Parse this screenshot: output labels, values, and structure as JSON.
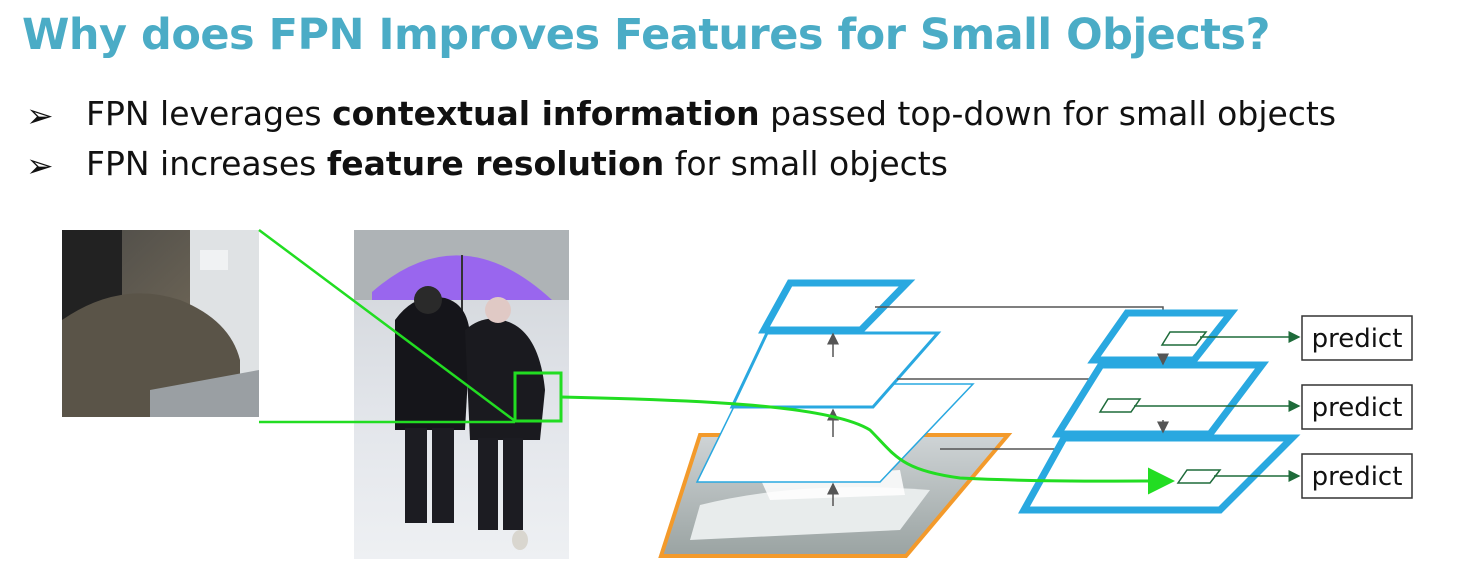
{
  "slide": {
    "title": "Why does FPN Improves Features for Small Objects?",
    "bullets": [
      {
        "pre": "FPN leverages ",
        "bold": "contextual information",
        "post": " passed top-down for small objects"
      },
      {
        "pre": "FPN increases ",
        "bold": "feature resolution",
        "post": " for small objects"
      }
    ]
  },
  "diagram": {
    "predict_labels": [
      "predict",
      "predict",
      "predict"
    ],
    "colors": {
      "pyramid_blue": "#29a8e0",
      "highlight_green": "#22dd22",
      "image_orange": "#f39a2b",
      "arrow_gray": "#555555",
      "arrow_dark_green": "#1e6b3a",
      "umbrella_purple": "#9966ee"
    }
  }
}
